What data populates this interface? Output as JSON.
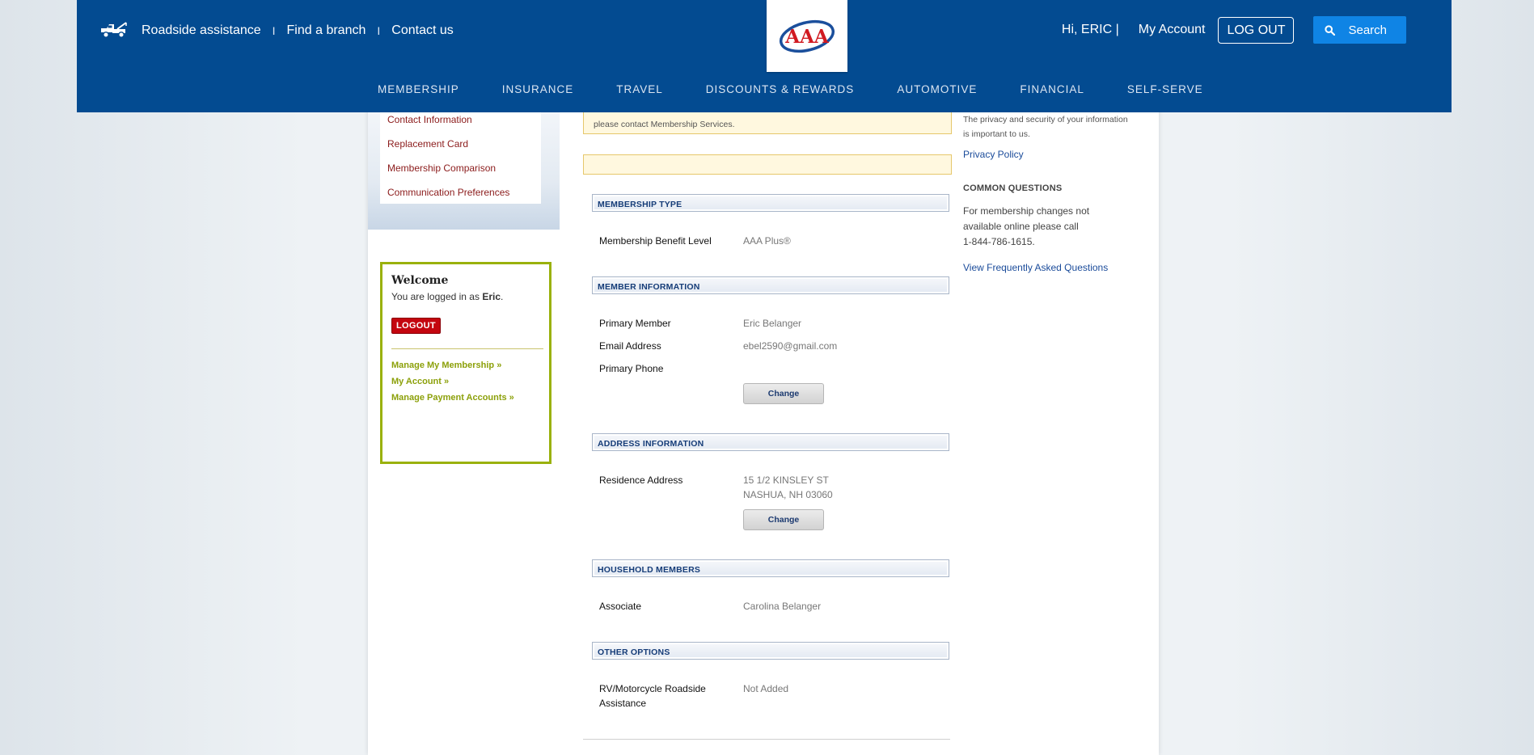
{
  "header": {
    "utility_links": [
      "Roadside assistance",
      "Find a branch",
      "Contact us"
    ],
    "utility_separator": "I",
    "greeting": "Hi, ERIC |",
    "my_account": "My Account",
    "logout": "LOG OUT",
    "search": "Search",
    "logo_text": "AAA",
    "brand_color": "#034b91",
    "nav": [
      "MEMBERSHIP",
      "INSURANCE",
      "TRAVEL",
      "DISCOUNTS & REWARDS",
      "AUTOMOTIVE",
      "FINANCIAL",
      "SELF-SERVE"
    ]
  },
  "sidebar": {
    "menu": [
      "Contact Information",
      "Replacement Card",
      "Membership Comparison",
      "Communication Preferences"
    ],
    "welcome": {
      "title": "Welcome",
      "logged_prefix": "You are logged in as ",
      "user": "Eric",
      "logged_suffix": ".",
      "logout": "LOGOUT",
      "links": [
        "Manage My Membership »",
        "My Account »",
        "Manage Payment Accounts »"
      ]
    }
  },
  "main": {
    "notice": "please contact Membership Services.",
    "sections": {
      "membership_type": {
        "title": "MEMBERSHIP TYPE",
        "benefit_label": "Membership Benefit Level",
        "benefit_value": "AAA Plus®"
      },
      "member_info": {
        "title": "MEMBER INFORMATION",
        "primary_label": "Primary Member",
        "primary_value": "Eric Belanger",
        "email_label": "Email Address",
        "email_value": "ebel2590@gmail.com",
        "phone_label": "Primary Phone",
        "phone_value": "",
        "change": "Change"
      },
      "address": {
        "title": "ADDRESS INFORMATION",
        "residence_label": "Residence Address",
        "line1": "15 1/2 KINSLEY ST",
        "line2": "NASHUA, NH 03060",
        "change": "Change"
      },
      "household": {
        "title": "HOUSEHOLD MEMBERS",
        "associate_label": "Associate",
        "associate_value": "Carolina Belanger"
      },
      "other": {
        "title": "OTHER OPTIONS",
        "rv_label_line1": "RV/Motorcycle Roadside",
        "rv_label_line2": "Assistance",
        "rv_value": "Not Added"
      }
    }
  },
  "right": {
    "privacy_text_1": "The privacy and security of your information",
    "privacy_text_2": "is important to us.",
    "privacy_link": "Privacy Policy",
    "common_questions": "COMMON QUESTIONS",
    "cq_line1": "For membership changes not",
    "cq_line2": "available online please call",
    "cq_line3": "1-844-786-1615.",
    "faq_link": "View Frequently Asked Questions"
  }
}
